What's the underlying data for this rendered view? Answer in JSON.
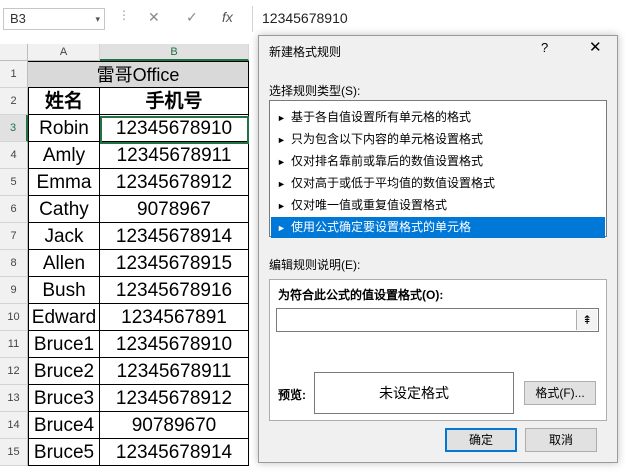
{
  "formula_bar": {
    "name_box": "B3",
    "dropdown_glyph": "▾",
    "dots": "⋮",
    "cancel_glyph": "✕",
    "enter_glyph": "✓",
    "fx_glyph": "fx",
    "value": "12345678910"
  },
  "sheet": {
    "columns": [
      "A",
      "B"
    ],
    "title": "雷哥Office",
    "headers": [
      "姓名",
      "手机号"
    ],
    "rows": [
      {
        "num": "1"
      },
      {
        "num": "2"
      },
      {
        "num": "3",
        "name": "Robin",
        "phone": "12345678910"
      },
      {
        "num": "4",
        "name": "Amly",
        "phone": "12345678911"
      },
      {
        "num": "5",
        "name": "Emma",
        "phone": "12345678912"
      },
      {
        "num": "6",
        "name": "Cathy",
        "phone": "9078967"
      },
      {
        "num": "7",
        "name": "Jack",
        "phone": "12345678914"
      },
      {
        "num": "8",
        "name": "Allen",
        "phone": "12345678915"
      },
      {
        "num": "9",
        "name": "Bush",
        "phone": "12345678916"
      },
      {
        "num": "10",
        "name": "Edward",
        "phone": "1234567891"
      },
      {
        "num": "11",
        "name": "Bruce1",
        "phone": "12345678910"
      },
      {
        "num": "12",
        "name": "Bruce2",
        "phone": "12345678911"
      },
      {
        "num": "13",
        "name": "Bruce3",
        "phone": "12345678912"
      },
      {
        "num": "14",
        "name": "Bruce4",
        "phone": "90789670"
      },
      {
        "num": "15",
        "name": "Bruce5",
        "phone": "12345678914"
      }
    ]
  },
  "dialog": {
    "title": "新建格式规则",
    "help": "?",
    "close": "✕",
    "rule_type_label": "选择规则类型(S):",
    "rule_types": [
      "基于各自值设置所有单元格的格式",
      "只为包含以下内容的单元格设置格式",
      "仅对排名靠前或靠后的数值设置格式",
      "仅对高于或低于平均值的数值设置格式",
      "仅对唯一值或重复值设置格式",
      "使用公式确定要设置格式的单元格"
    ],
    "selected_rule_index": 5,
    "edit_desc_label": "编辑规则说明(E):",
    "formula_label": "为符合此公式的值设置格式(O):",
    "formula_value": "",
    "picker_glyph": "⇞",
    "preview_label": "预览:",
    "preview_text": "未设定格式",
    "format_button": "格式(F)...",
    "ok_button": "确定",
    "cancel_button": "取消",
    "accent_color": "#0078d7"
  },
  "colors": {
    "excel_green": "#217346",
    "title_fill": "#d9d9d9"
  }
}
